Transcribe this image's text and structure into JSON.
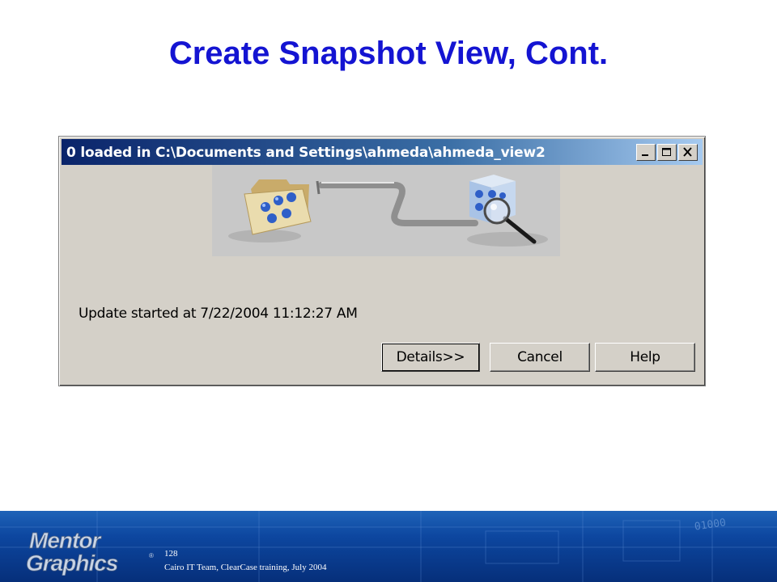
{
  "slide": {
    "title": "Create Snapshot View, Cont."
  },
  "dialog": {
    "title": "0 loaded in C:\\Documents and Settings\\ahmeda\\ahmeda_view2",
    "status": "Update started at 7/22/2004 11:12:27 AM",
    "buttons": {
      "details": "Details>>",
      "cancel": "Cancel",
      "help": "Help"
    },
    "caption_icons": [
      "minimize-icon",
      "maximize-icon",
      "close-icon"
    ]
  },
  "footer": {
    "page_number": "128",
    "text": "Cairo IT Team, ClearCase training, July 2004",
    "logo_text": "Mentor Graphics",
    "decor_number": "01000"
  },
  "colors": {
    "title": "#1414d2",
    "titlebar_start": "#0a246a",
    "titlebar_end": "#a6caf0",
    "dialog_bg": "#d4d0c8",
    "footer_bg": "#0d47a0"
  }
}
